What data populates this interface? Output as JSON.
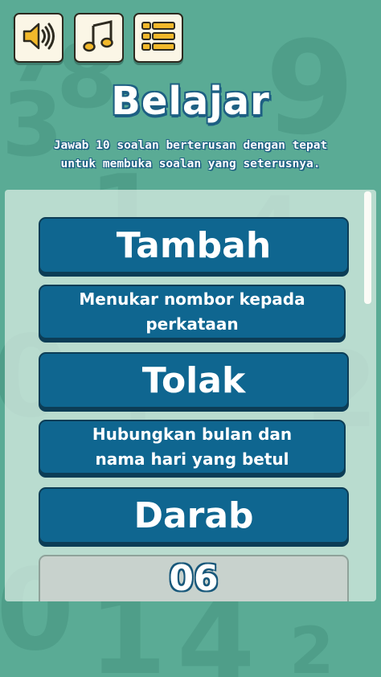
{
  "toolbar": {
    "sound_icon": "speaker-icon",
    "music_icon": "music-note-icon",
    "menu_icon": "list-menu-icon"
  },
  "header": {
    "title": "Belajar",
    "subtitle_line1": "Jawab 10 soalan berterusan dengan tepat",
    "subtitle_line2": "untuk membuka soalan yang seterusnya."
  },
  "lessons": [
    {
      "label": "Tambah"
    },
    {
      "label_line1": "Menukar nombor kepada",
      "label_line2": "perkataan"
    },
    {
      "label": "Tolak"
    },
    {
      "label_line1": "Hubungkan bulan dan",
      "label_line2": "nama hari yang betul"
    },
    {
      "label": "Darab"
    },
    {
      "label": "06",
      "locked": true
    }
  ],
  "background_digits": [
    "7",
    "3",
    "8",
    "9",
    "0",
    "1",
    "4",
    "2",
    "5",
    "0",
    "1",
    "4",
    "2"
  ],
  "colors": {
    "background": "#5aab95",
    "button": "#0f6690",
    "button_border": "#0c3d56",
    "title_outline": "#1d5f83"
  }
}
